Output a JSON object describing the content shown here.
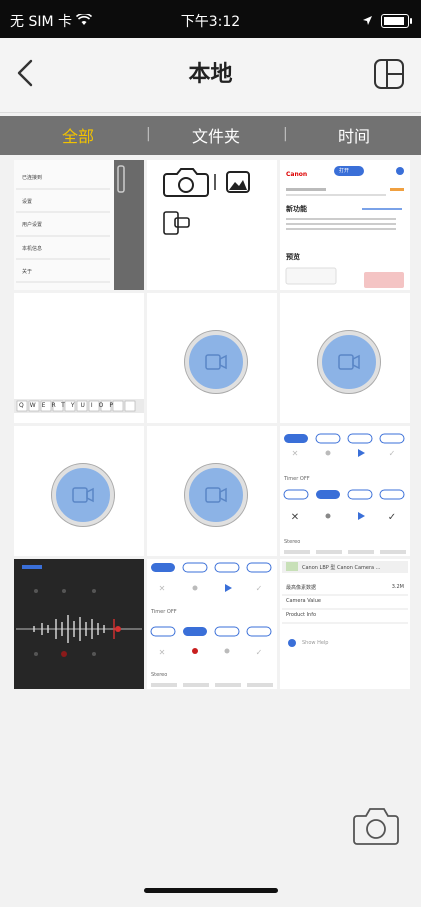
{
  "statusbar": {
    "carrier": "无 SIM 卡",
    "time": "下午3:12"
  },
  "nav": {
    "title": "本地"
  },
  "segments": {
    "all": "全部",
    "folder": "文件夹",
    "time": "时间"
  },
  "thumbs": {
    "settings": [
      "已连接到",
      "设置",
      "用户设置",
      "本机信息",
      "关于"
    ],
    "appinfo": {
      "brand": "Canon",
      "button": "打开",
      "section1": "新功能",
      "section2": "预览"
    },
    "keys": "QWERTYUIOP",
    "mode": {
      "label": "Timer OFF",
      "label2": "Stereo"
    },
    "info": {
      "title": "Canon LBP 型 Canon Camera ...",
      "row1": "最高像素数据",
      "row1_val": "3.2M",
      "row2": "Camera Value",
      "row3": "Product Info",
      "link": "Show Help"
    }
  },
  "icons": {
    "status_wifi": "wifi-icon",
    "status_location": "location-icon",
    "status_battery": "battery-icon",
    "back": "chevron-left-icon",
    "layout": "layout-icon",
    "camera": "camera-icon"
  }
}
